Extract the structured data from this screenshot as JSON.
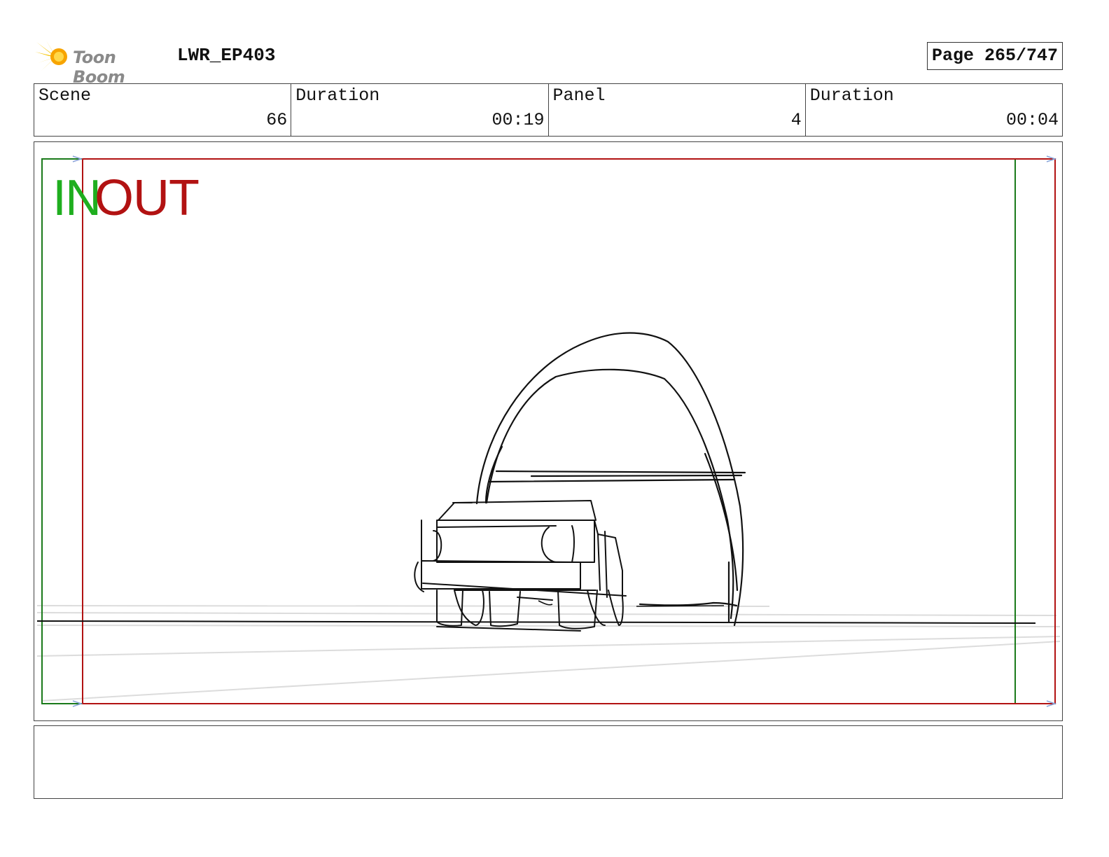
{
  "header": {
    "brand": "Toon Boom",
    "project": "LWR_EP403",
    "page": "Page 265/747"
  },
  "info": {
    "scene_label": "Scene",
    "scene_value": "66",
    "scene_duration_label": "Duration",
    "scene_duration_value": "00:19",
    "panel_label": "Panel",
    "panel_value": "4",
    "panel_duration_label": "Duration",
    "panel_duration_value": "00:04"
  },
  "frame": {
    "in_label": "IN",
    "out_label": "OUT",
    "in_color": "#1fae1f",
    "out_color": "#b21212"
  },
  "notes": {
    "text": ""
  },
  "icons": {
    "logo": "starburst-logo-icon"
  }
}
